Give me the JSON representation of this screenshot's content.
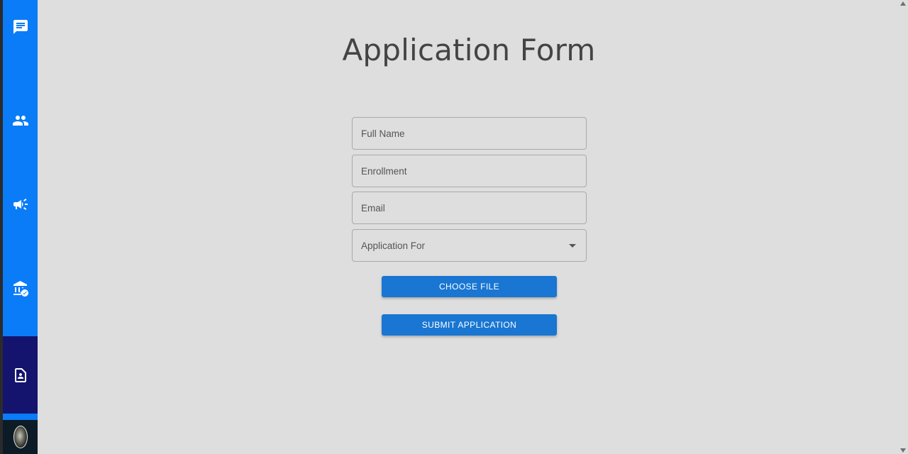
{
  "sidebar": {
    "items": [
      {
        "icon": "chat-icon"
      },
      {
        "icon": "people-icon"
      },
      {
        "icon": "campaign-icon"
      },
      {
        "icon": "bank-verified-icon"
      },
      {
        "icon": "contact-page-icon",
        "active": true
      }
    ],
    "colors": {
      "background": "#0a7cf8",
      "active": "#14146e"
    }
  },
  "page": {
    "title": "Application Form"
  },
  "form": {
    "full_name_placeholder": "Full Name",
    "enrollment_placeholder": "Enrollment",
    "email_placeholder": "Email",
    "application_for_label": "Application For",
    "choose_file_label": "CHOOSE FILE",
    "submit_label": "SUBMIT APPLICATION"
  },
  "colors": {
    "button": "#1976d2",
    "page_background": "#dedede"
  }
}
